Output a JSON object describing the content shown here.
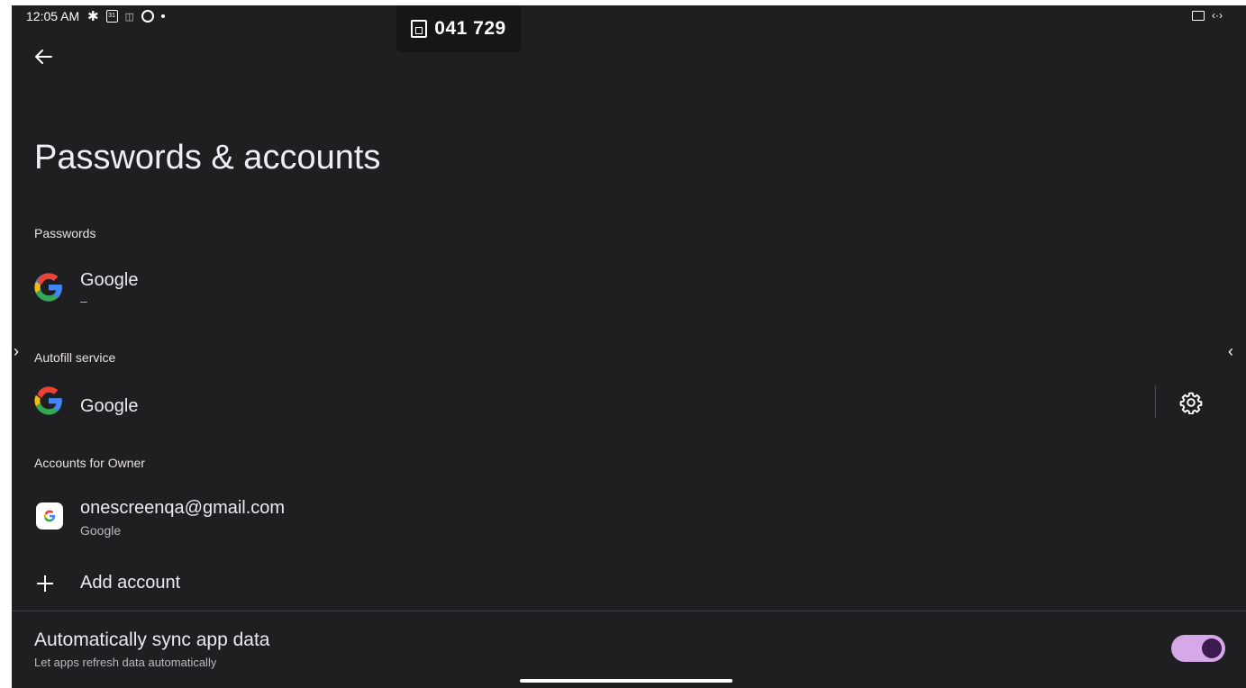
{
  "status_bar": {
    "time": "12:05 AM",
    "calendar_day": "31",
    "pairing_code": "041 729",
    "right_indicator": "‹·›"
  },
  "page": {
    "title": "Passwords & accounts"
  },
  "sections": {
    "passwords": {
      "header": "Passwords",
      "item_title": "Google",
      "item_subtitle": "–"
    },
    "autofill": {
      "header": "Autofill service",
      "item_title": "Google"
    },
    "accounts": {
      "header": "Accounts for Owner",
      "account_email": "onescreenqa@gmail.com",
      "account_type": "Google",
      "add_account_label": "Add account"
    }
  },
  "sync": {
    "title": "Automatically sync app data",
    "subtitle": "Let apps refresh data automatically",
    "enabled": true
  },
  "icons": {
    "back": "arrow-back-icon",
    "google": "google-g-icon",
    "settings": "gear-icon",
    "add": "plus-icon"
  },
  "colors": {
    "background": "#1f1f21",
    "toggle_track": "#d6a8e8",
    "toggle_knob": "#3d1a4d"
  }
}
